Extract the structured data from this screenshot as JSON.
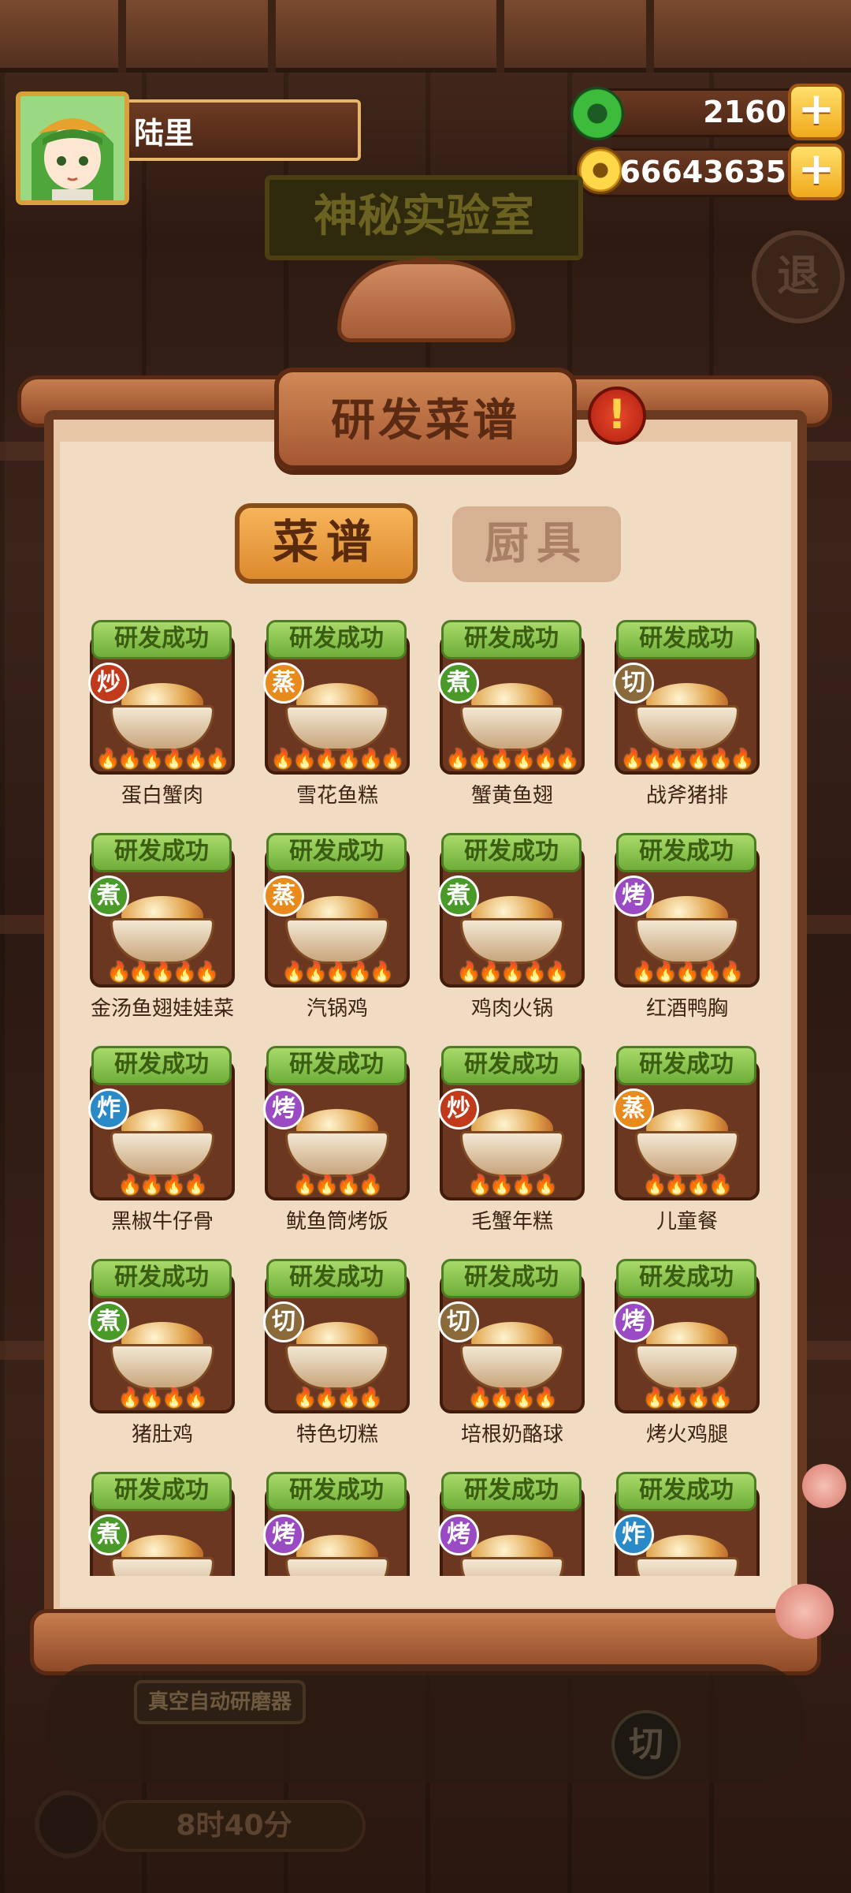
{
  "player": {
    "name": "陆里"
  },
  "resources": {
    "jade": "2160",
    "coins": "66643635"
  },
  "background": {
    "lab_sign": "神秘实验室",
    "exit_label": "退",
    "machine_label": "真空自动研磨器",
    "cut_label": "切",
    "timer": "8时40分"
  },
  "panel": {
    "title": "研发菜谱",
    "alert": "!"
  },
  "tabs": {
    "recipes": "菜谱",
    "tools": "厨具"
  },
  "status_label": "研发成功",
  "flames_glyph": "🔥",
  "recipes": [
    {
      "name": "蛋白蟹肉",
      "method": "炒",
      "flames": 6
    },
    {
      "name": "雪花鱼糕",
      "method": "蒸",
      "flames": 6
    },
    {
      "name": "蟹黄鱼翅",
      "method": "煮",
      "flames": 6
    },
    {
      "name": "战斧猪排",
      "method": "切",
      "flames": 6
    },
    {
      "name": "金汤鱼翅娃娃菜",
      "method": "煮",
      "flames": 5
    },
    {
      "name": "汽锅鸡",
      "method": "蒸",
      "flames": 5
    },
    {
      "name": "鸡肉火锅",
      "method": "煮",
      "flames": 5
    },
    {
      "name": "红酒鸭胸",
      "method": "烤",
      "flames": 5
    },
    {
      "name": "黑椒牛仔骨",
      "method": "炸",
      "flames": 4
    },
    {
      "name": "鱿鱼筒烤饭",
      "method": "烤",
      "flames": 4
    },
    {
      "name": "毛蟹年糕",
      "method": "炒",
      "flames": 4
    },
    {
      "name": "儿童餐",
      "method": "蒸",
      "flames": 4
    },
    {
      "name": "猪肚鸡",
      "method": "煮",
      "flames": 4
    },
    {
      "name": "特色切糕",
      "method": "切",
      "flames": 4
    },
    {
      "name": "培根奶酪球",
      "method": "切",
      "flames": 4
    },
    {
      "name": "烤火鸡腿",
      "method": "烤",
      "flames": 4
    },
    {
      "name": "",
      "method": "煮",
      "flames": 0
    },
    {
      "name": "",
      "method": "烤",
      "flames": 0
    },
    {
      "name": "",
      "method": "烤",
      "flames": 0
    },
    {
      "name": "",
      "method": "炸",
      "flames": 0
    }
  ],
  "method_colors": {
    "炒": "#c23a1c",
    "蒸": "#e88a1c",
    "煮": "#4a9a2a",
    "切": "#8a6a3a",
    "烤": "#9a4ac2",
    "炸": "#2a8ac8"
  }
}
